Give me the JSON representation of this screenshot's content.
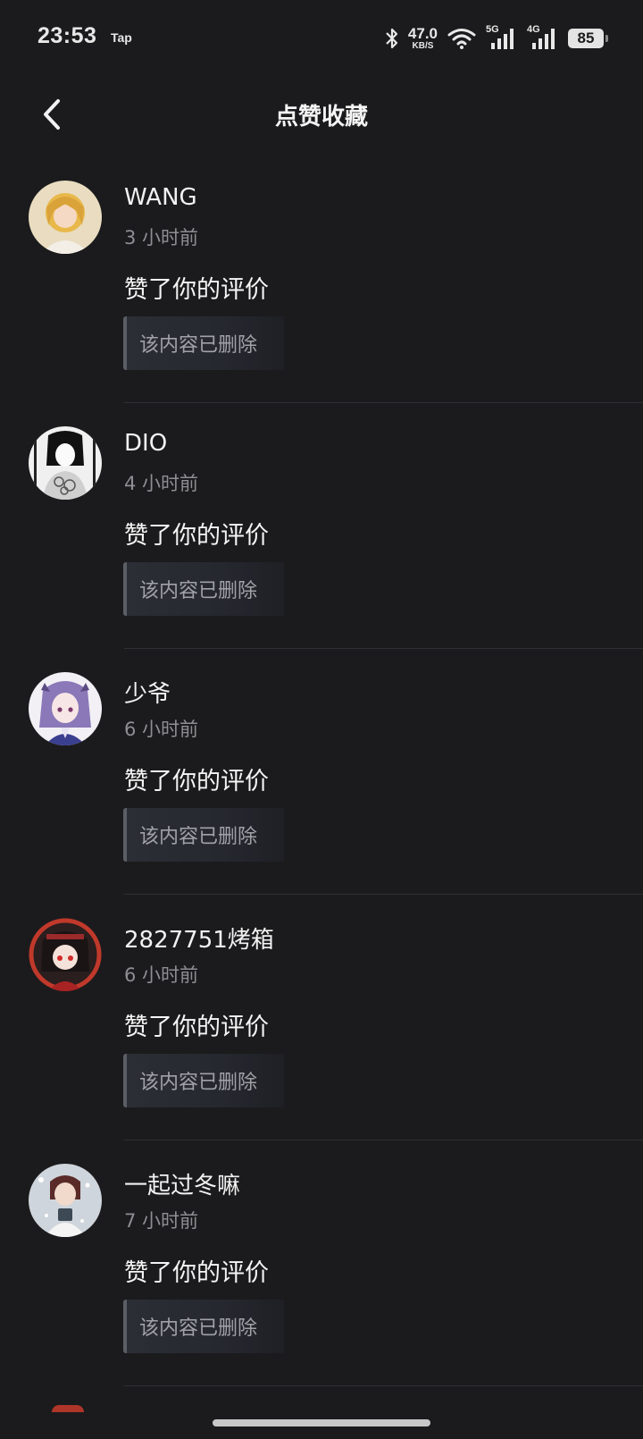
{
  "status_bar": {
    "time": "23:53",
    "app_tag": "Tap",
    "net_speed_value": "47.0",
    "net_speed_unit": "KB/S",
    "signal1_tag": "5G",
    "signal2_tag": "4G",
    "battery": "85",
    "icons": [
      "bluetooth-icon",
      "wifi-icon",
      "signal-5g-icon",
      "signal-4g-icon",
      "battery-icon"
    ]
  },
  "header": {
    "title": "点赞收藏",
    "back_icon": "chevron-left-icon"
  },
  "feed": [
    {
      "username": "WANG",
      "time": "3 小时前",
      "action": "赞了你的评价",
      "quote": "该内容已删除",
      "avatar_color": "#d8b87a"
    },
    {
      "username": "DIO",
      "time": "4 小时前",
      "action": "赞了你的评价",
      "quote": "该内容已删除",
      "avatar_color": "#e8e8e8"
    },
    {
      "username": "少爷",
      "time": "6 小时前",
      "action": "赞了你的评价",
      "quote": "该内容已删除",
      "avatar_color": "#b9a9d6"
    },
    {
      "username": "2827751烤箱",
      "time": "6 小时前",
      "action": "赞了你的评价",
      "quote": "该内容已删除",
      "avatar_color": "#8b1d1d"
    },
    {
      "username": "一起过冬嘛",
      "time": "7 小时前",
      "action": "赞了你的评价",
      "quote": "该内容已删除",
      "avatar_color": "#9aa3ad"
    }
  ]
}
